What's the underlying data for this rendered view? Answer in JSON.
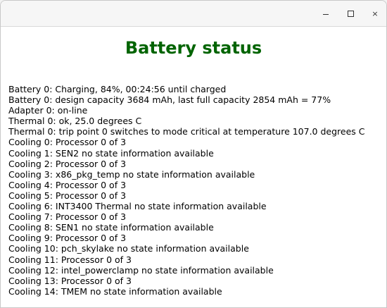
{
  "window": {
    "controls": {
      "minimize_icon": "minimize-icon",
      "maximize_icon": "maximize-icon",
      "close_icon": "close-icon",
      "close_glyph": "×"
    }
  },
  "page": {
    "title": "Battery status",
    "title_color": "#006400",
    "lines": [
      "Battery 0: Charging, 84%, 00:24:56 until charged",
      "Battery 0: design capacity 3684 mAh, last full capacity 2854 mAh = 77%",
      "Adapter 0: on-line",
      "Thermal 0: ok, 25.0 degrees C",
      "Thermal 0: trip point 0 switches to mode critical at temperature 107.0 degrees C",
      "Cooling 0: Processor 0 of 3",
      "Cooling 1: SEN2 no state information available",
      "Cooling 2: Processor 0 of 3",
      "Cooling 3: x86_pkg_temp no state information available",
      "Cooling 4: Processor 0 of 3",
      "Cooling 5: Processor 0 of 3",
      "Cooling 6: INT3400 Thermal no state information available",
      "Cooling 7: Processor 0 of 3",
      "Cooling 8: SEN1 no state information available",
      "Cooling 9: Processor 0 of 3",
      "Cooling 10: pch_skylake no state information available",
      "Cooling 11: Processor 0 of 3",
      "Cooling 12: intel_powerclamp no state information available",
      "Cooling 13: Processor 0 of 3",
      "Cooling 14: TMEM no state information available"
    ]
  }
}
